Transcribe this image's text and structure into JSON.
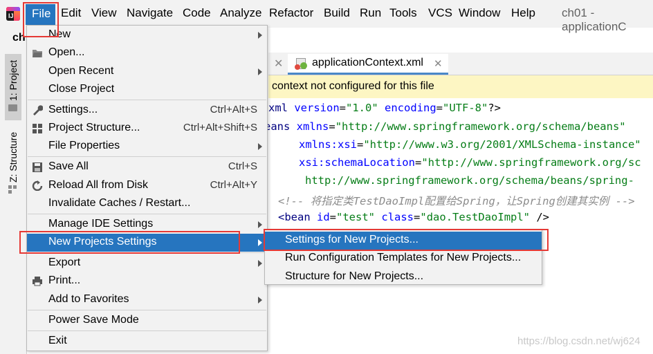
{
  "menubar": {
    "logo_text": "IJ",
    "items": [
      "File",
      "Edit",
      "View",
      "Navigate",
      "Code",
      "Analyze",
      "Refactor",
      "Build",
      "Run",
      "Tools",
      "VCS",
      "Window",
      "Help"
    ],
    "window_title": "ch01 - applicationC"
  },
  "project_header": "ch",
  "left_strip": {
    "project_tab": "1: Project",
    "structure_tab": "Z: Structure"
  },
  "editor": {
    "tab_label": "applicationContext.xml",
    "notice": "context not configured for this file",
    "lines": [
      "xml version=\"1.0\" encoding=\"UTF-8\"?>",
      "eans xmlns=\"http://www.springframework.org/schema/beans\"",
      "xmlns:xsi=\"http://www.w3.org/2001/XMLSchema-instance\"",
      "xsi:schemaLocation=\"http://www.springframework.org/sc",
      "http://www.springframework.org/schema/beans/spring-",
      "<!-- 将指定类TestDaoImpl配置给Spring，让Spring创建其实例 -->",
      "<bean id=\"test\" class=\"dao.TestDaoImpl\" />"
    ]
  },
  "file_menu": {
    "items": [
      {
        "label": "New",
        "shortcut": "",
        "submenu": true
      },
      {
        "label": "Open...",
        "shortcut": "",
        "submenu": false
      },
      {
        "label": "Open Recent",
        "shortcut": "",
        "submenu": true
      },
      {
        "label": "Close Project",
        "shortcut": "",
        "submenu": false
      },
      {
        "label": "Settings...",
        "shortcut": "Ctrl+Alt+S",
        "submenu": false
      },
      {
        "label": "Project Structure...",
        "shortcut": "Ctrl+Alt+Shift+S",
        "submenu": false
      },
      {
        "label": "File Properties",
        "shortcut": "",
        "submenu": true
      },
      {
        "label": "Save All",
        "shortcut": "Ctrl+S",
        "submenu": false
      },
      {
        "label": "Reload All from Disk",
        "shortcut": "Ctrl+Alt+Y",
        "submenu": false
      },
      {
        "label": "Invalidate Caches / Restart...",
        "shortcut": "",
        "submenu": false
      },
      {
        "label": "Manage IDE Settings",
        "shortcut": "",
        "submenu": true
      },
      {
        "label": "New Projects Settings",
        "shortcut": "",
        "submenu": true,
        "selected": true
      },
      {
        "label": "Export",
        "shortcut": "",
        "submenu": true
      },
      {
        "label": "Print...",
        "shortcut": "",
        "submenu": false
      },
      {
        "label": "Add to Favorites",
        "shortcut": "",
        "submenu": true
      },
      {
        "label": "Power Save Mode",
        "shortcut": "",
        "submenu": false
      },
      {
        "label": "Exit",
        "shortcut": "",
        "submenu": false
      }
    ]
  },
  "submenu": {
    "items": [
      {
        "label": "Settings for New Projects...",
        "selected": true
      },
      {
        "label": "Run Configuration Templates for New Projects..."
      },
      {
        "label": "Structure for New Projects..."
      }
    ]
  },
  "watermark": "https://blog.csdn.net/wj624",
  "colors": {
    "selection": "#2675bf",
    "highlight_box": "#e53935",
    "notice_bg": "#fdf6c3"
  }
}
